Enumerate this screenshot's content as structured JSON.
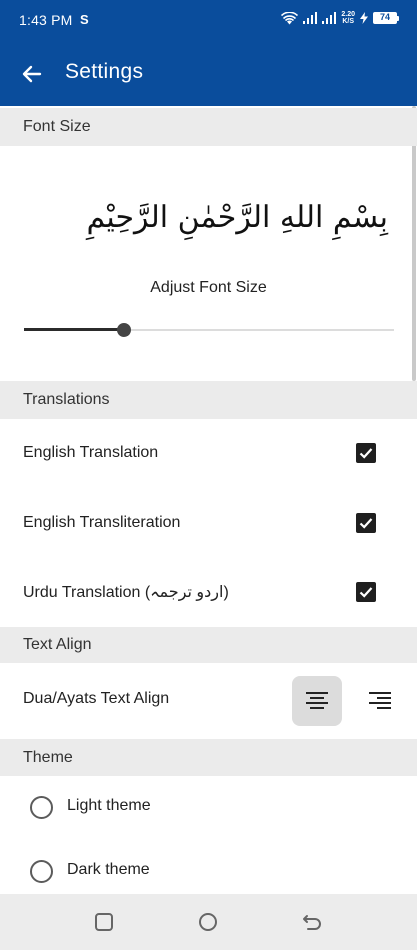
{
  "status_bar": {
    "time": "1:43 PM",
    "notification_icon": "S",
    "net_speed_value": "2.20",
    "net_speed_unit": "K/S",
    "battery_level": "74"
  },
  "app_bar": {
    "title": "Settings",
    "back_icon": "arrow-left"
  },
  "font_size": {
    "header": "Font Size",
    "preview_text": "بِسْمِ اللهِ الرَّحْمٰنِ الرَّحِيْمِ",
    "adjust_label": "Adjust Font Size",
    "slider_value_fraction": 0.27
  },
  "translations": {
    "header": "Translations",
    "items": [
      {
        "label": "English Translation",
        "checked": true
      },
      {
        "label": "English Transliteration",
        "checked": true
      },
      {
        "label": "Urdu Translation (اردو ترجمہ)",
        "checked": true
      }
    ]
  },
  "text_align": {
    "header": "Text Align",
    "label": "Dua/Ayats Text Align",
    "options": [
      {
        "icon": "align-center-icon",
        "selected": true
      },
      {
        "icon": "align-right-icon",
        "selected": false
      }
    ]
  },
  "theme": {
    "header": "Theme",
    "options": [
      {
        "label": "Light theme",
        "selected": false
      },
      {
        "label": "Dark theme",
        "selected": false
      }
    ]
  },
  "colors": {
    "primary": "#0a4d9c",
    "section_bg": "#ebebeb",
    "checkbox": "#1f1f1f"
  }
}
